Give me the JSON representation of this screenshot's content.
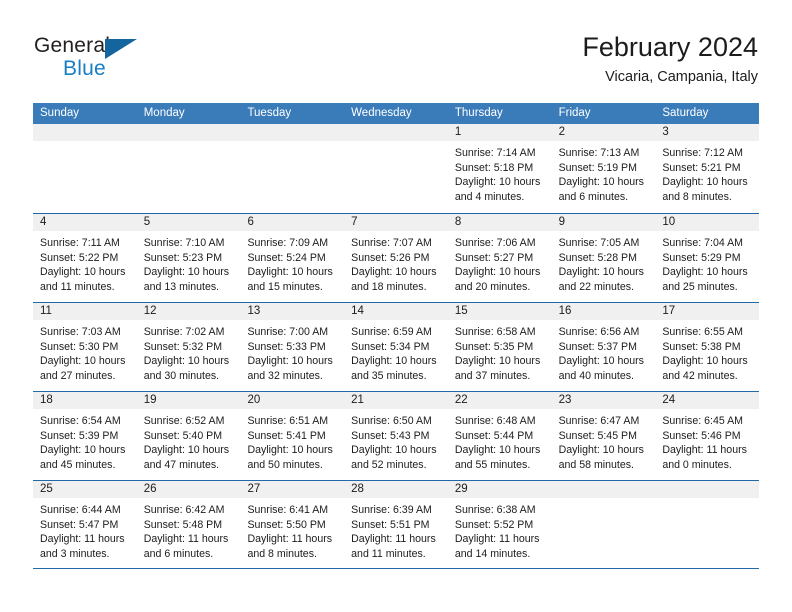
{
  "brand": {
    "word_one": "General",
    "word_two": "Blue",
    "triangle_color": "#14659e",
    "blue_color": "#1a7ec4"
  },
  "header": {
    "month_title": "February 2024",
    "location": "Vicaria, Campania, Italy"
  },
  "theme": {
    "header_blue": "#3a7cba",
    "row_rule_blue": "#1f69ab",
    "daynum_band": "#f0f0f0"
  },
  "weekdays": [
    "Sunday",
    "Monday",
    "Tuesday",
    "Wednesday",
    "Thursday",
    "Friday",
    "Saturday"
  ],
  "weeks": [
    [
      {
        "day": "",
        "empty": true,
        "sunrise": "",
        "sunset": "",
        "daylight_1": "",
        "daylight_2": ""
      },
      {
        "day": "",
        "empty": true,
        "sunrise": "",
        "sunset": "",
        "daylight_1": "",
        "daylight_2": ""
      },
      {
        "day": "",
        "empty": true,
        "sunrise": "",
        "sunset": "",
        "daylight_1": "",
        "daylight_2": ""
      },
      {
        "day": "",
        "empty": true,
        "sunrise": "",
        "sunset": "",
        "daylight_1": "",
        "daylight_2": ""
      },
      {
        "day": "1",
        "sunrise": "Sunrise: 7:14 AM",
        "sunset": "Sunset: 5:18 PM",
        "daylight_1": "Daylight: 10 hours",
        "daylight_2": "and 4 minutes."
      },
      {
        "day": "2",
        "sunrise": "Sunrise: 7:13 AM",
        "sunset": "Sunset: 5:19 PM",
        "daylight_1": "Daylight: 10 hours",
        "daylight_2": "and 6 minutes."
      },
      {
        "day": "3",
        "sunrise": "Sunrise: 7:12 AM",
        "sunset": "Sunset: 5:21 PM",
        "daylight_1": "Daylight: 10 hours",
        "daylight_2": "and 8 minutes."
      }
    ],
    [
      {
        "day": "4",
        "sunrise": "Sunrise: 7:11 AM",
        "sunset": "Sunset: 5:22 PM",
        "daylight_1": "Daylight: 10 hours",
        "daylight_2": "and 11 minutes."
      },
      {
        "day": "5",
        "sunrise": "Sunrise: 7:10 AM",
        "sunset": "Sunset: 5:23 PM",
        "daylight_1": "Daylight: 10 hours",
        "daylight_2": "and 13 minutes."
      },
      {
        "day": "6",
        "sunrise": "Sunrise: 7:09 AM",
        "sunset": "Sunset: 5:24 PM",
        "daylight_1": "Daylight: 10 hours",
        "daylight_2": "and 15 minutes."
      },
      {
        "day": "7",
        "sunrise": "Sunrise: 7:07 AM",
        "sunset": "Sunset: 5:26 PM",
        "daylight_1": "Daylight: 10 hours",
        "daylight_2": "and 18 minutes."
      },
      {
        "day": "8",
        "sunrise": "Sunrise: 7:06 AM",
        "sunset": "Sunset: 5:27 PM",
        "daylight_1": "Daylight: 10 hours",
        "daylight_2": "and 20 minutes."
      },
      {
        "day": "9",
        "sunrise": "Sunrise: 7:05 AM",
        "sunset": "Sunset: 5:28 PM",
        "daylight_1": "Daylight: 10 hours",
        "daylight_2": "and 22 minutes."
      },
      {
        "day": "10",
        "sunrise": "Sunrise: 7:04 AM",
        "sunset": "Sunset: 5:29 PM",
        "daylight_1": "Daylight: 10 hours",
        "daylight_2": "and 25 minutes."
      }
    ],
    [
      {
        "day": "11",
        "sunrise": "Sunrise: 7:03 AM",
        "sunset": "Sunset: 5:30 PM",
        "daylight_1": "Daylight: 10 hours",
        "daylight_2": "and 27 minutes."
      },
      {
        "day": "12",
        "sunrise": "Sunrise: 7:02 AM",
        "sunset": "Sunset: 5:32 PM",
        "daylight_1": "Daylight: 10 hours",
        "daylight_2": "and 30 minutes."
      },
      {
        "day": "13",
        "sunrise": "Sunrise: 7:00 AM",
        "sunset": "Sunset: 5:33 PM",
        "daylight_1": "Daylight: 10 hours",
        "daylight_2": "and 32 minutes."
      },
      {
        "day": "14",
        "sunrise": "Sunrise: 6:59 AM",
        "sunset": "Sunset: 5:34 PM",
        "daylight_1": "Daylight: 10 hours",
        "daylight_2": "and 35 minutes."
      },
      {
        "day": "15",
        "sunrise": "Sunrise: 6:58 AM",
        "sunset": "Sunset: 5:35 PM",
        "daylight_1": "Daylight: 10 hours",
        "daylight_2": "and 37 minutes."
      },
      {
        "day": "16",
        "sunrise": "Sunrise: 6:56 AM",
        "sunset": "Sunset: 5:37 PM",
        "daylight_1": "Daylight: 10 hours",
        "daylight_2": "and 40 minutes."
      },
      {
        "day": "17",
        "sunrise": "Sunrise: 6:55 AM",
        "sunset": "Sunset: 5:38 PM",
        "daylight_1": "Daylight: 10 hours",
        "daylight_2": "and 42 minutes."
      }
    ],
    [
      {
        "day": "18",
        "sunrise": "Sunrise: 6:54 AM",
        "sunset": "Sunset: 5:39 PM",
        "daylight_1": "Daylight: 10 hours",
        "daylight_2": "and 45 minutes."
      },
      {
        "day": "19",
        "sunrise": "Sunrise: 6:52 AM",
        "sunset": "Sunset: 5:40 PM",
        "daylight_1": "Daylight: 10 hours",
        "daylight_2": "and 47 minutes."
      },
      {
        "day": "20",
        "sunrise": "Sunrise: 6:51 AM",
        "sunset": "Sunset: 5:41 PM",
        "daylight_1": "Daylight: 10 hours",
        "daylight_2": "and 50 minutes."
      },
      {
        "day": "21",
        "sunrise": "Sunrise: 6:50 AM",
        "sunset": "Sunset: 5:43 PM",
        "daylight_1": "Daylight: 10 hours",
        "daylight_2": "and 52 minutes."
      },
      {
        "day": "22",
        "sunrise": "Sunrise: 6:48 AM",
        "sunset": "Sunset: 5:44 PM",
        "daylight_1": "Daylight: 10 hours",
        "daylight_2": "and 55 minutes."
      },
      {
        "day": "23",
        "sunrise": "Sunrise: 6:47 AM",
        "sunset": "Sunset: 5:45 PM",
        "daylight_1": "Daylight: 10 hours",
        "daylight_2": "and 58 minutes."
      },
      {
        "day": "24",
        "sunrise": "Sunrise: 6:45 AM",
        "sunset": "Sunset: 5:46 PM",
        "daylight_1": "Daylight: 11 hours",
        "daylight_2": "and 0 minutes."
      }
    ],
    [
      {
        "day": "25",
        "sunrise": "Sunrise: 6:44 AM",
        "sunset": "Sunset: 5:47 PM",
        "daylight_1": "Daylight: 11 hours",
        "daylight_2": "and 3 minutes."
      },
      {
        "day": "26",
        "sunrise": "Sunrise: 6:42 AM",
        "sunset": "Sunset: 5:48 PM",
        "daylight_1": "Daylight: 11 hours",
        "daylight_2": "and 6 minutes."
      },
      {
        "day": "27",
        "sunrise": "Sunrise: 6:41 AM",
        "sunset": "Sunset: 5:50 PM",
        "daylight_1": "Daylight: 11 hours",
        "daylight_2": "and 8 minutes."
      },
      {
        "day": "28",
        "sunrise": "Sunrise: 6:39 AM",
        "sunset": "Sunset: 5:51 PM",
        "daylight_1": "Daylight: 11 hours",
        "daylight_2": "and 11 minutes."
      },
      {
        "day": "29",
        "sunrise": "Sunrise: 6:38 AM",
        "sunset": "Sunset: 5:52 PM",
        "daylight_1": "Daylight: 11 hours",
        "daylight_2": "and 14 minutes."
      },
      {
        "day": "",
        "empty": true,
        "sunrise": "",
        "sunset": "",
        "daylight_1": "",
        "daylight_2": ""
      },
      {
        "day": "",
        "empty": true,
        "sunrise": "",
        "sunset": "",
        "daylight_1": "",
        "daylight_2": ""
      }
    ]
  ]
}
